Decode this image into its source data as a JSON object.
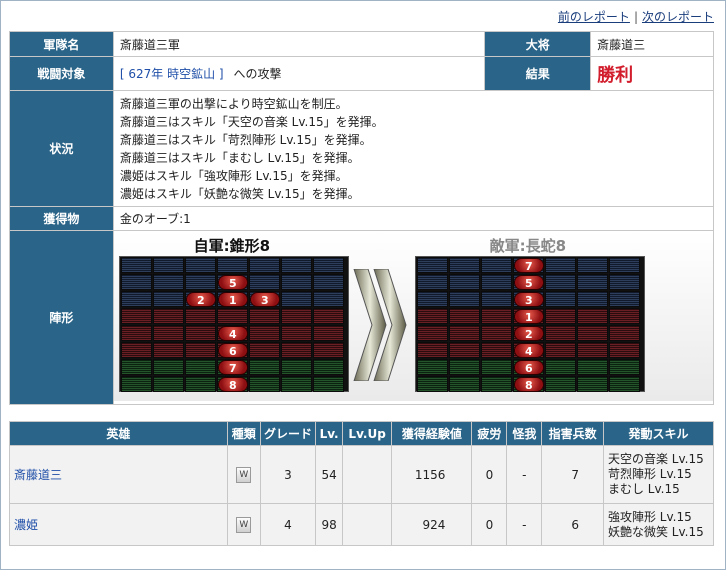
{
  "nav": {
    "prev": "前のレポート",
    "sep": "|",
    "next": "次のレポート"
  },
  "report": {
    "army_label": "軍隊名",
    "army_value": "斎藤道三軍",
    "general_label": "大将",
    "general_value": "斎藤道三",
    "target_label": "戦闘対象",
    "target_open": "[",
    "target_link": "627年 時空鉱山",
    "target_close": "]",
    "target_suffix": "への攻撃",
    "result_label": "結果",
    "result_value": "勝利",
    "status_label": "状況",
    "status_lines": [
      "斎藤道三軍の出撃により時空鉱山を制圧。",
      "斎藤道三はスキル「天空の音楽 Lv.15」を発揮。",
      "斎藤道三はスキル「苛烈陣形 Lv.15」を発揮。",
      "斎藤道三はスキル「まむし Lv.15」を発揮。",
      "濃姫はスキル「強攻陣形 Lv.15」を発揮。",
      "濃姫はスキル「妖艶な微笑 Lv.15」を発揮。"
    ],
    "loot_label": "獲得物",
    "loot_value": "金のオーブ:1",
    "formation_label": "陣形",
    "own_formation": "自軍:錐形8",
    "enemy_formation": "敵軍:長蛇8"
  },
  "formations": {
    "own_tokens": [
      {
        "label": "5",
        "row": 1,
        "col": 3
      },
      {
        "label": "2",
        "row": 2,
        "col": 2
      },
      {
        "label": "1",
        "row": 2,
        "col": 3
      },
      {
        "label": "3",
        "row": 2,
        "col": 4
      },
      {
        "label": "4",
        "row": 4,
        "col": 3
      },
      {
        "label": "6",
        "row": 5,
        "col": 3
      },
      {
        "label": "7",
        "row": 6,
        "col": 3
      },
      {
        "label": "8",
        "row": 7,
        "col": 3
      }
    ],
    "enemy_tokens": [
      {
        "label": "7",
        "row": 0,
        "col": 3
      },
      {
        "label": "5",
        "row": 1,
        "col": 3
      },
      {
        "label": "3",
        "row": 2,
        "col": 3
      },
      {
        "label": "1",
        "row": 3,
        "col": 3
      },
      {
        "label": "2",
        "row": 4,
        "col": 3
      },
      {
        "label": "4",
        "row": 5,
        "col": 3
      },
      {
        "label": "6",
        "row": 6,
        "col": 3
      },
      {
        "label": "8",
        "row": 7,
        "col": 3
      }
    ],
    "row_colors": [
      "blue",
      "blue",
      "blue",
      "red",
      "red",
      "red",
      "green",
      "green"
    ],
    "colors": {
      "blue": "#1d2f4f",
      "red": "#5a1519",
      "green": "#1b4420",
      "token": "#b3161b",
      "header": "#2a6488",
      "win": "#d21d2c"
    }
  },
  "heroes": {
    "headers": [
      "英雄",
      "種類",
      "グレード",
      "Lv.",
      "Lv.Up",
      "獲得経験値",
      "疲労",
      "怪我",
      "指害兵数",
      "発動スキル"
    ],
    "rows": [
      {
        "name": "斎藤道三",
        "type": "W",
        "grade": "3",
        "lv": "54",
        "lvup": "",
        "exp": "1156",
        "fatigue": "0",
        "injury": "-",
        "losses": "7",
        "skills": [
          "天空の音楽 Lv.15",
          "苛烈陣形 Lv.15",
          "まむし Lv.15"
        ]
      },
      {
        "name": "濃姫",
        "type": "W",
        "grade": "4",
        "lv": "98",
        "lvup": "",
        "exp": "924",
        "fatigue": "0",
        "injury": "-",
        "losses": "6",
        "skills": [
          "強攻陣形 Lv.15",
          "妖艶な微笑 Lv.15"
        ]
      }
    ]
  }
}
